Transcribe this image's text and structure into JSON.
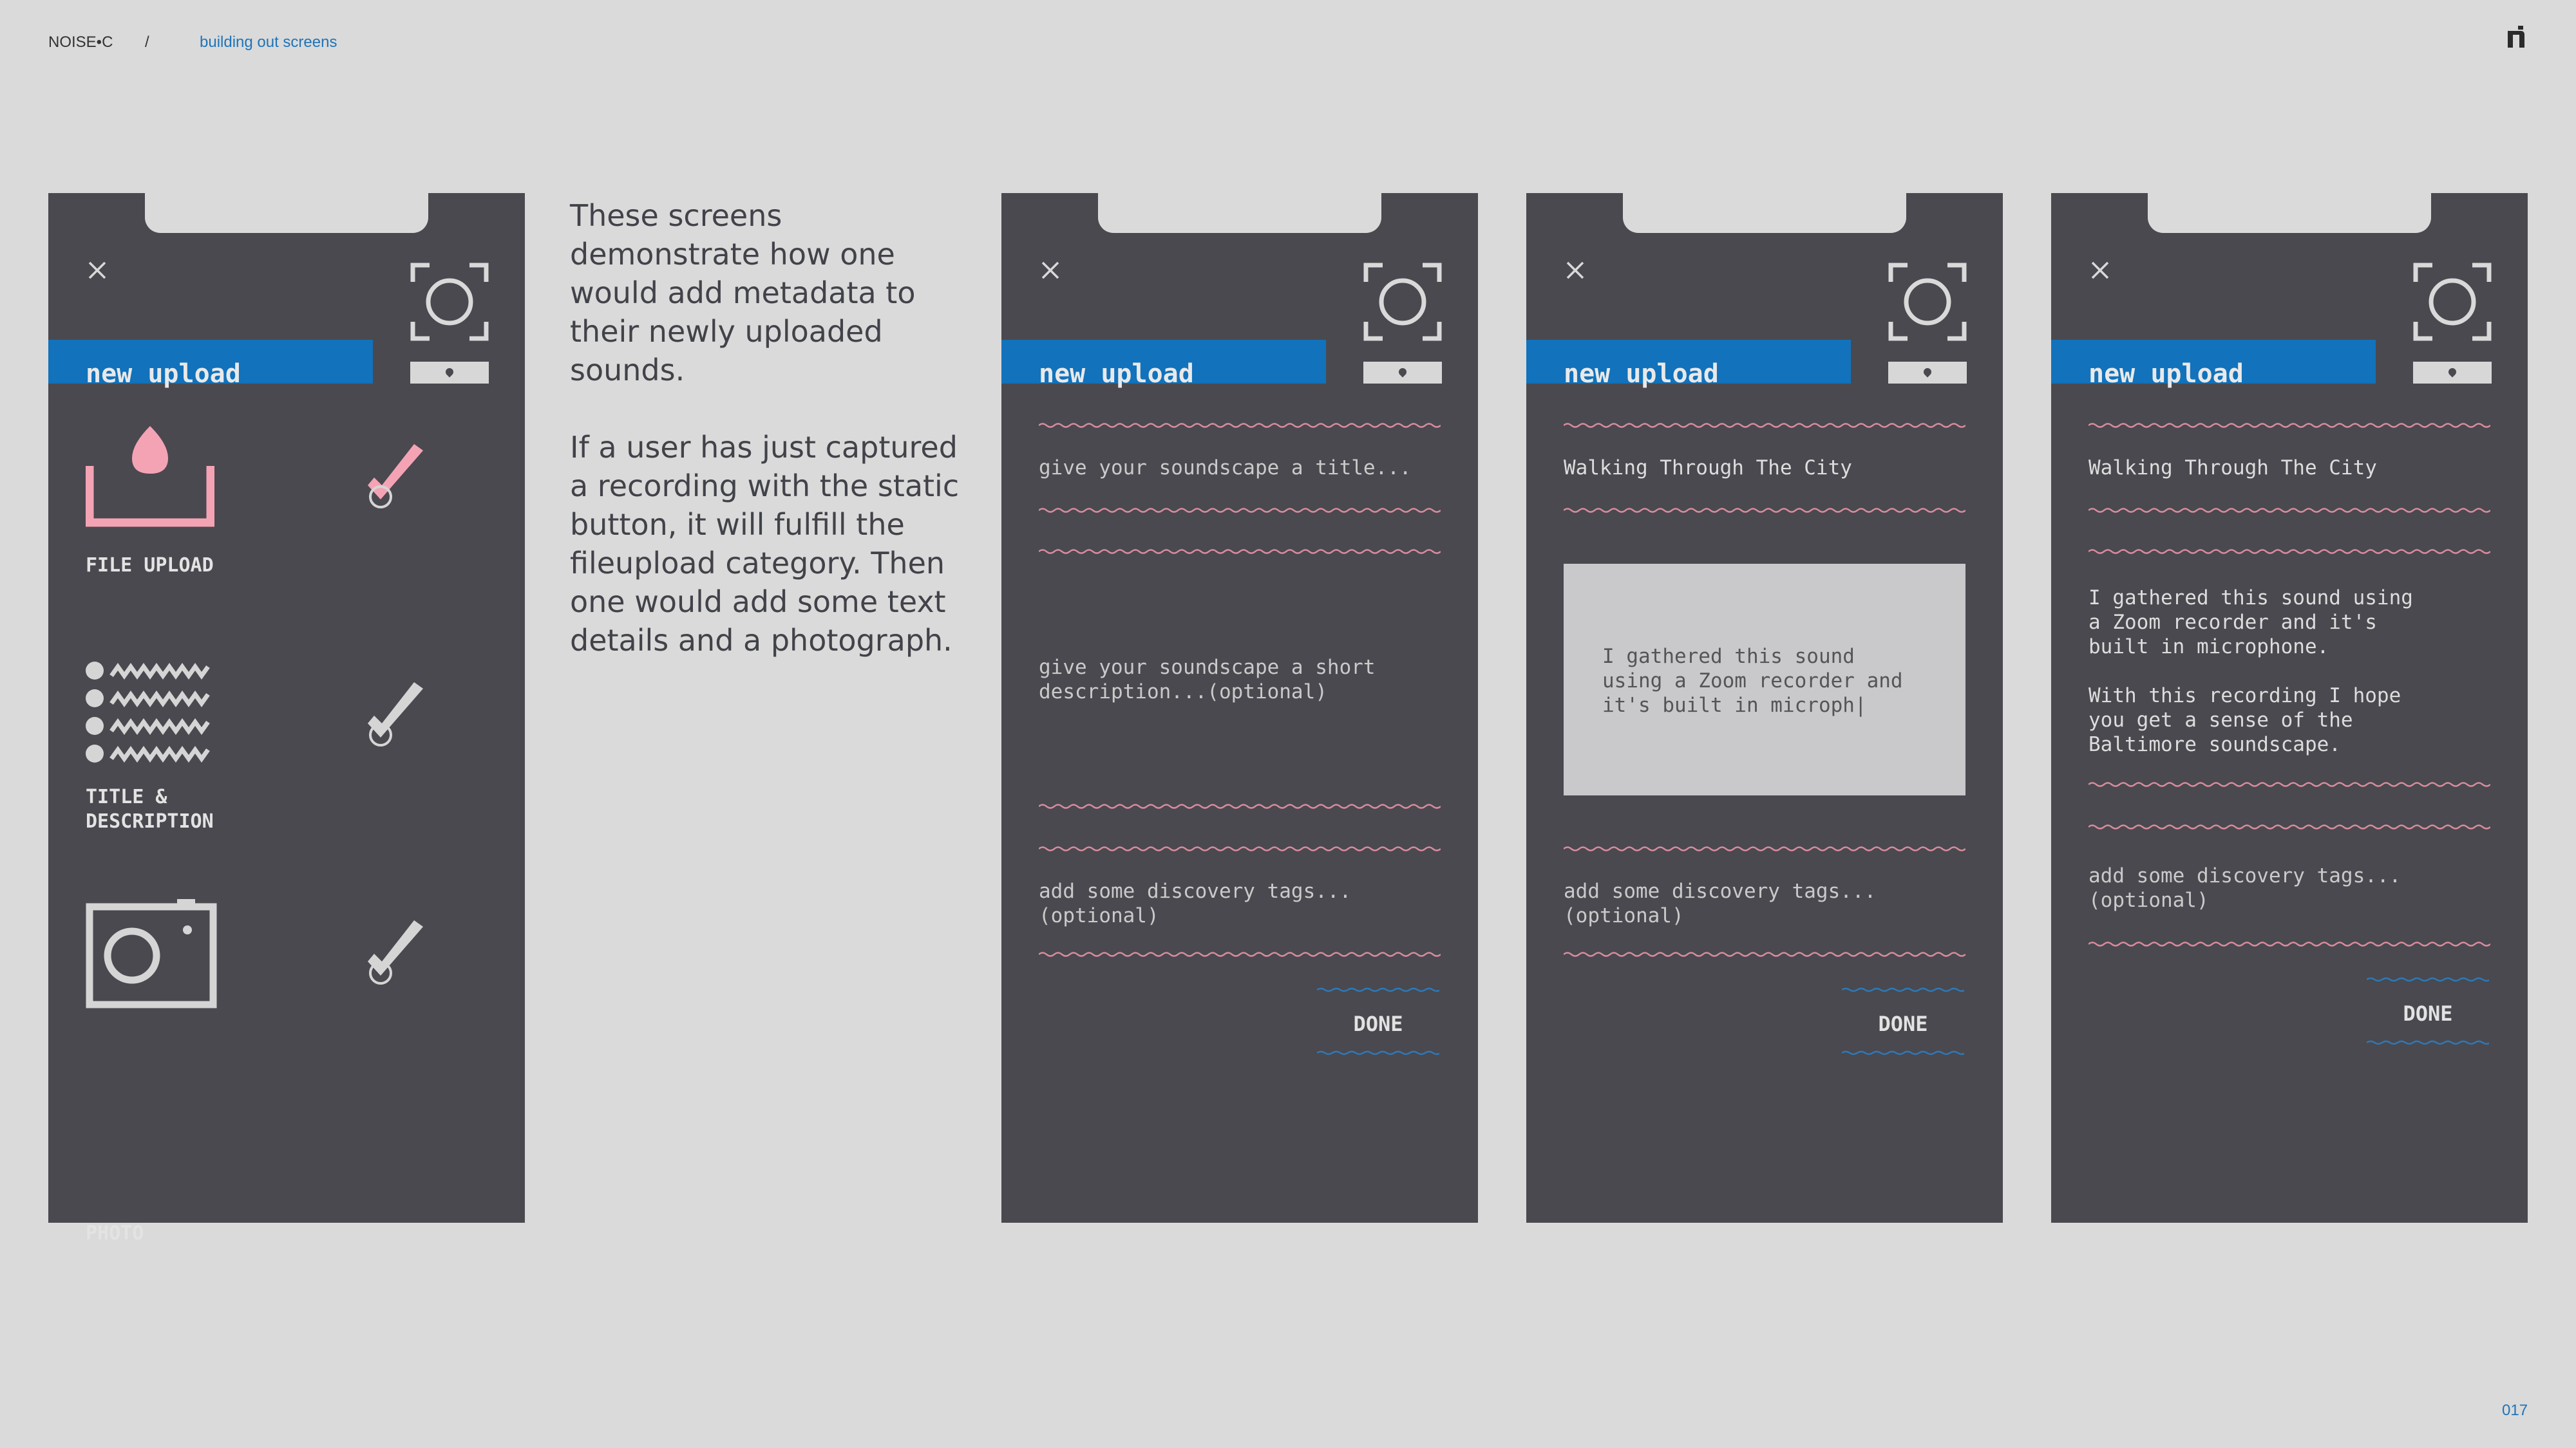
{
  "header": {
    "brand": "NOISE•C",
    "separator": "/",
    "current": "building out screens"
  },
  "page_number": "017",
  "intro": {
    "p1": "These screens demonstrate how one would add metadata to their newly uploaded sounds.",
    "p2": "If a user has just captured a recording with the static button, it will fulfill the fileupload category. Then one would add some text details and a photograph."
  },
  "colors": {
    "background": "#dadada",
    "phone": "#49494f",
    "accent_blue": "#1272bb",
    "accent_pink": "#f4a3b5",
    "light": "#d7d7d7"
  },
  "icons": [
    "close-icon",
    "camera-focus-icon",
    "file-upload-icon",
    "title-description-icon",
    "photo-icon",
    "checkmark-icon"
  ],
  "screen1": {
    "title": "new upload",
    "items": [
      {
        "label": "FILE UPLOAD",
        "completed": true
      },
      {
        "label": "TITLE &\nDESCRIPTION",
        "completed": false
      },
      {
        "label": "PHOTO",
        "completed": false
      }
    ]
  },
  "screen2": {
    "title": "new upload",
    "title_placeholder": "give your soundscape a title...",
    "description_placeholder": "give your soundscape a short\ndescription...(optional)",
    "tags_placeholder": "add some discovery tags...\n(optional)",
    "done_label": "DONE"
  },
  "screen3": {
    "title": "new upload",
    "title_value": "Walking Through The City",
    "description_value": "I gathered this sound\nusing a Zoom recorder and\nit's built in microph|",
    "tags_placeholder": "add some discovery tags...\n(optional)",
    "done_label": "DONE"
  },
  "screen4": {
    "title": "new upload",
    "title_value": "Walking Through The City",
    "description_p1": "I gathered this sound using\na Zoom recorder and it's\nbuilt in microphone.",
    "description_p2": "With this recording I hope\nyou get a sense of the\nBaltimore soundscape.",
    "tags_placeholder": "add some discovery tags...\n(optional)",
    "done_label": "DONE"
  }
}
